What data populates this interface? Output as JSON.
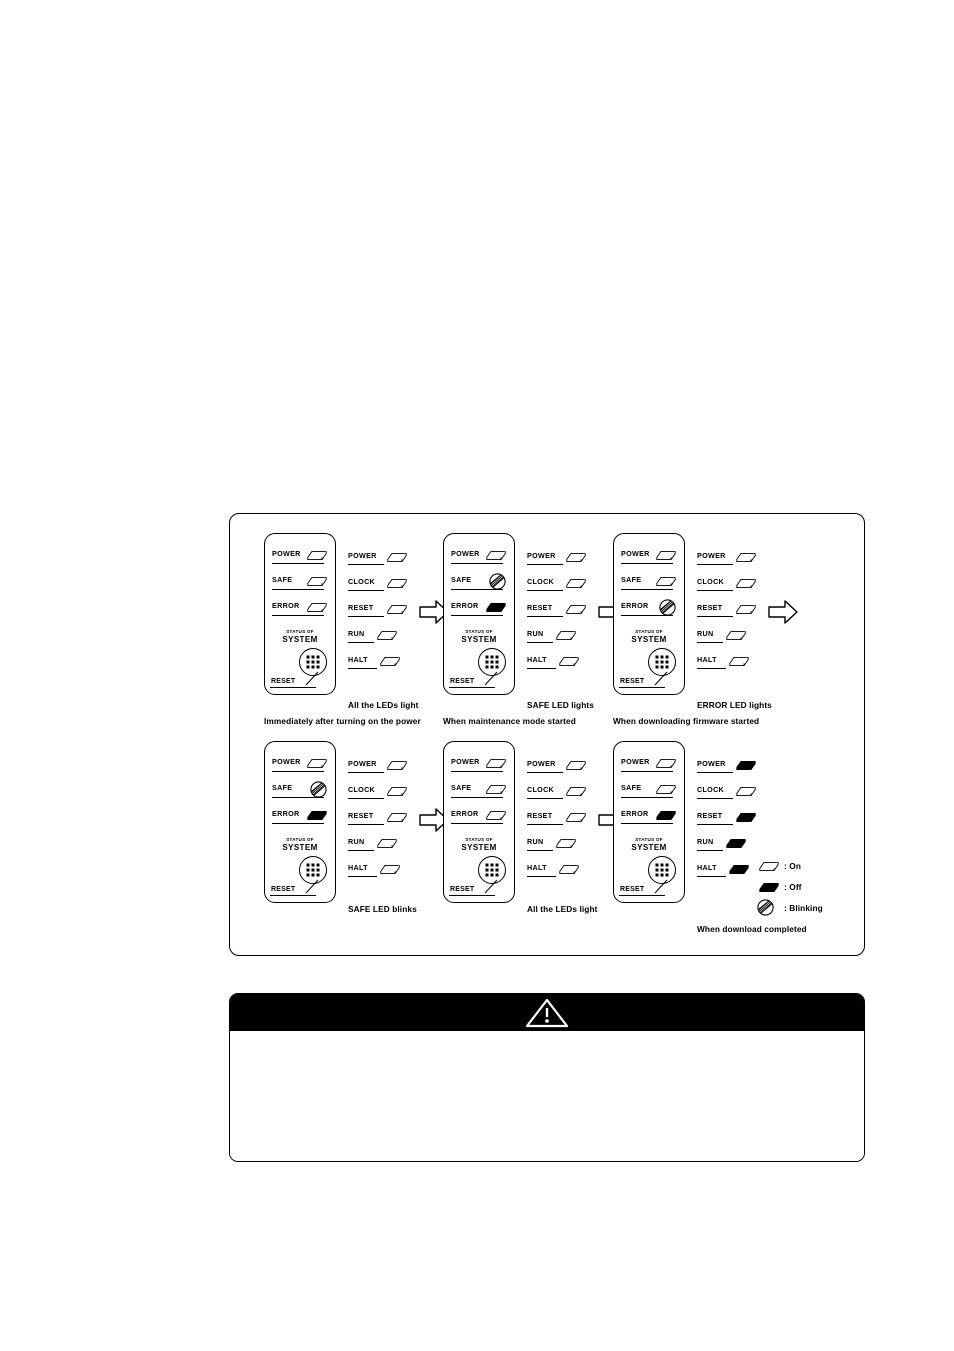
{
  "figure": {
    "legend": {
      "items": [
        {
          "icon": "led-on-icon",
          "state": "on",
          "label": ": On"
        },
        {
          "icon": "led-off-icon",
          "state": "off",
          "label": ": Off"
        },
        {
          "icon": "led-blinking-icon",
          "state": "blinking",
          "label": ": Blinking"
        }
      ]
    },
    "panel": {
      "status_of_label": "STATUS OF",
      "system_label": "SYSTEM",
      "reset_label": "RESET",
      "led_labels": [
        "POWER",
        "SAFE",
        "ERROR"
      ]
    },
    "led_column": {
      "labels": [
        "POWER",
        "CLOCK",
        "RESET",
        "RUN",
        "HALT"
      ]
    },
    "stages": [
      {
        "id": "stage-power-on",
        "panel_states": [
          "on",
          "on",
          "on"
        ],
        "column_states": [
          "on",
          "on",
          "on",
          "on",
          "on"
        ],
        "state_caption": "All the LEDs light",
        "event_caption": "Immediately after turning on the power",
        "has_arrow": true
      },
      {
        "id": "stage-maintenance-mode",
        "panel_states": [
          "on",
          "blinking",
          "off"
        ],
        "column_states": [
          "on",
          "on",
          "on",
          "on",
          "on"
        ],
        "state_caption": "SAFE LED lights",
        "event_caption": "When maintenance mode started",
        "has_arrow": true
      },
      {
        "id": "stage-download-started",
        "panel_states": [
          "on",
          "on",
          "blinking"
        ],
        "column_states": [
          "on",
          "on",
          "on",
          "on",
          "on"
        ],
        "state_caption": "ERROR LED lights",
        "event_caption": "When downloading firmware started",
        "has_arrow": true
      },
      {
        "id": "stage-safe-blinks",
        "panel_states": [
          "on",
          "blinking",
          "off"
        ],
        "column_states": [
          "on",
          "on",
          "on",
          "on",
          "on"
        ],
        "state_caption": "SAFE LED blinks",
        "event_caption": "",
        "has_arrow": true
      },
      {
        "id": "stage-all-leds-light",
        "panel_states": [
          "on",
          "on",
          "on"
        ],
        "column_states": [
          "on",
          "on",
          "on",
          "on",
          "on"
        ],
        "state_caption": "All the LEDs light",
        "event_caption": "",
        "has_arrow": true
      },
      {
        "id": "stage-download-completed",
        "panel_states": [
          "on",
          "on",
          "off"
        ],
        "column_states": [
          "off",
          "on",
          "off",
          "off",
          "off"
        ],
        "state_caption": "",
        "event_caption": "When download completed",
        "has_arrow": false
      }
    ]
  },
  "caution": {
    "icon": "warning-triangle-icon",
    "header_text": "",
    "body_text": ""
  }
}
